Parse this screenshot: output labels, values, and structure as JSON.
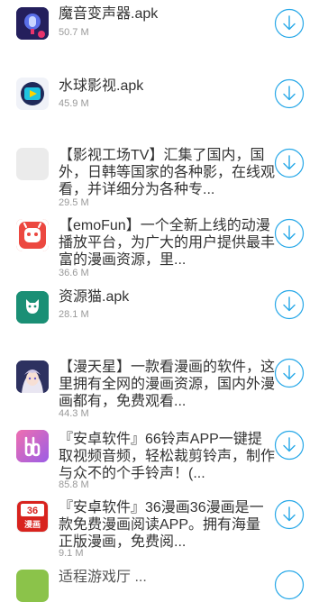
{
  "accent_color": "#27a8e8",
  "items": [
    {
      "title": "魔音变声器.apk",
      "size": "50.7 M",
      "icon": "voice-changer-app-icon"
    },
    {
      "title": "水球影视.apk",
      "size": "45.9 M",
      "icon": "video-play-app-icon"
    },
    {
      "title": "【影视工场TV】汇集了国内，国外，日韩等国家的各种影，在线观看，并详细分为各种专...",
      "size": "29.5 M",
      "icon": "placeholder-app-icon"
    },
    {
      "title": "【emoFun】一个全新上线的动漫播放平台，为广大的用户提供最丰富的漫画资源，里...",
      "size": "36.6 M",
      "icon": "emofun-app-icon"
    },
    {
      "title": "资源猫.apk",
      "size": "28.1 M",
      "icon": "cat-app-icon"
    },
    {
      "title": "【漫天星】一款看漫画的软件，这里拥有全网的漫画资源，国内外漫画都有，免费观看...",
      "size": "44.3 M",
      "icon": "anime-avatar-app-icon"
    },
    {
      "title": "『安卓软件』66铃声APP一键提取视频音频，轻松裁剪铃声，制作与众不的个手铃声！(...",
      "size": "85.8 M",
      "icon": "ringtone-app-icon"
    },
    {
      "title": "『安卓软件』36漫画36漫画是一款免费漫画阅读APP。拥有海量正版漫画，免费阅...",
      "size": "9.1 M",
      "icon": "comic-36-app-icon"
    },
    {
      "title": "适程游戏厅 ...",
      "size": "",
      "icon": "partial-app-icon"
    }
  ]
}
